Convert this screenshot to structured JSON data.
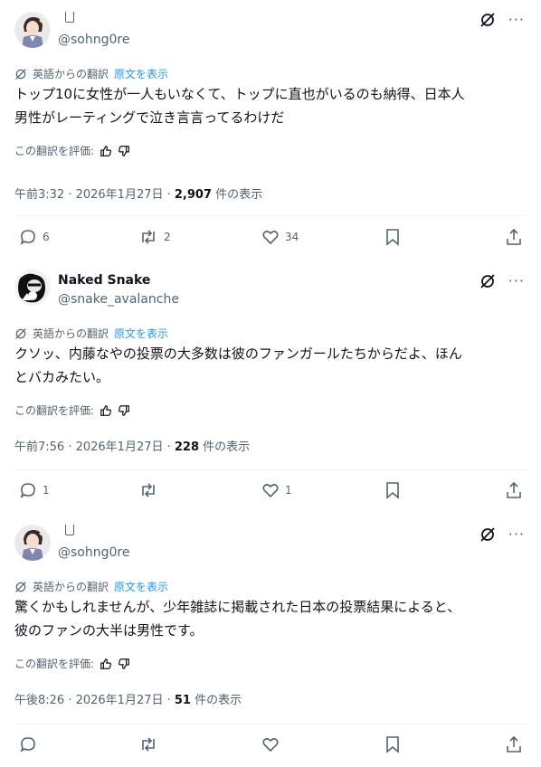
{
  "translation_label": "英語からの翻訳",
  "show_original_label": "原文を表示",
  "rate_label": "この翻訳を評価:",
  "views_suffix": " 件の表示",
  "colors": {
    "text": "#0f1419",
    "secondary": "#536471",
    "link": "#1d9bf0",
    "divider": "#eff3f4"
  },
  "tweets": [
    {
      "name": "",
      "handle": "@sohng0re",
      "text_line1": "トップ10に女性が一人もいなくて、トップに直也がいるのも納得、日本人",
      "text_line2": "男性がレーティングで泣き言言ってるわけだ",
      "time": "午前3:32 · 2026年1月27日 · ",
      "views": "2,907",
      "replies": "6",
      "reposts": "2",
      "likes": "34"
    },
    {
      "name": "Naked Snake",
      "handle": "@snake_avalanche",
      "text_line1": "クソッ、内藤なやの投票の大多数は彼のファンガールたちからだよ、ほん",
      "text_line2": "とバカみたい。",
      "time": "午前7:56 · 2026年1月27日 · ",
      "views": "228",
      "replies": "1",
      "reposts": "",
      "likes": "1"
    },
    {
      "name": "",
      "handle": "@sohng0re",
      "text_line1": "驚くかもしれませんが、少年雑誌に掲載された日本の投票結果によると、",
      "text_line2": "彼のファンの大半は男性です。",
      "time": "午後8:26 · 2026年1月27日 · ",
      "views": "51",
      "replies": "",
      "reposts": "",
      "likes": ""
    }
  ]
}
